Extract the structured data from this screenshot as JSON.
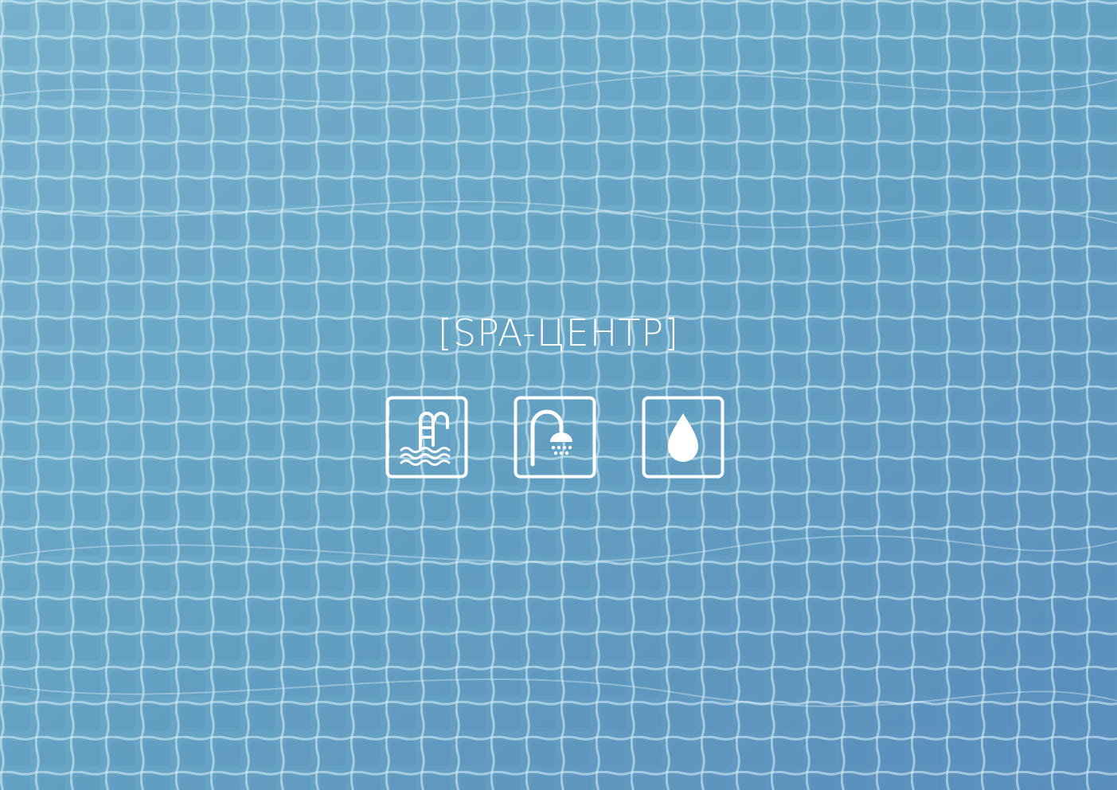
{
  "title": "[SPA-ЦЕНТР]",
  "icons": [
    {
      "name": "pool-icon"
    },
    {
      "name": "shower-icon"
    },
    {
      "name": "water-drop-icon"
    }
  ],
  "colors": {
    "background": "#6aa9c6",
    "foreground": "#ffffff"
  }
}
